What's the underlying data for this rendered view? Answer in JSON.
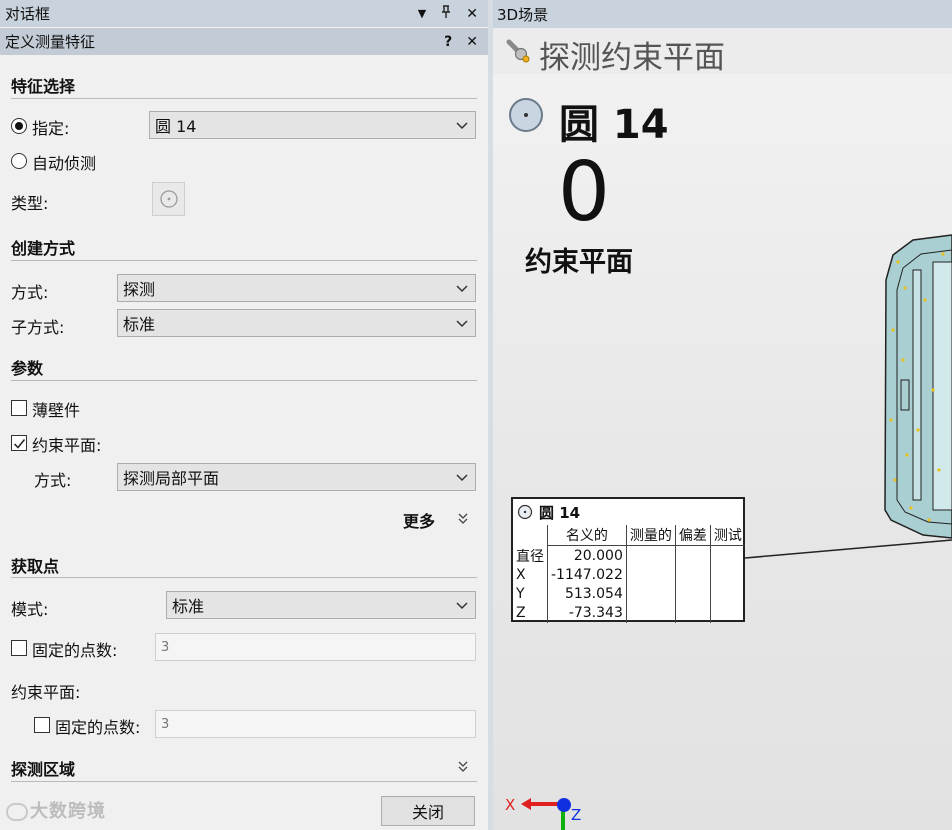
{
  "left_panel": {
    "window_title": "对话框",
    "dialog_title": "定义测量特征",
    "window_buttons": {
      "pin": "▼",
      "dock": "ᛘ",
      "close": "✕"
    },
    "dialog_buttons": {
      "help": "?",
      "close": "✕"
    },
    "feature_selection": {
      "header": "特征选择",
      "specify_label": "指定:",
      "specify_selected": true,
      "specify_value": "圆 14",
      "auto_detect_label": "自动侦测",
      "type_label": "类型:"
    },
    "creation_method": {
      "header": "创建方式",
      "method_label": "方式:",
      "method_value": "探测",
      "submethod_label": "子方式:",
      "submethod_value": "标准"
    },
    "parameters": {
      "header": "参数",
      "thin_wall_label": "薄壁件",
      "thin_wall_checked": false,
      "constraint_plane_label": "约束平面:",
      "constraint_plane_checked": true,
      "cp_method_label": "方式:",
      "cp_method_value": "探测局部平面",
      "more_label": "更多"
    },
    "acquire_points": {
      "header": "获取点",
      "mode_label": "模式:",
      "mode_value": "标准",
      "fixed_points_label": "固定的点数:",
      "fixed_points_checked": false,
      "fixed_points_value": "3",
      "constraint_plane_label": "约束平面:",
      "cp_fixed_points_label": "固定的点数:",
      "cp_fixed_points_checked": false,
      "cp_fixed_points_value": "3"
    },
    "probe_area": {
      "header": "探测区域"
    },
    "close_button": "关闭",
    "watermark": "大数跨境"
  },
  "scene": {
    "window_title": "3D场景",
    "title": "探测约束平面",
    "feature_name": "圆 14",
    "counter_value": "0",
    "counter_label": "约束平面",
    "info_box": {
      "title": "圆 14",
      "columns": [
        "",
        "名义的",
        "测量的",
        "偏差",
        "测试"
      ],
      "rows": [
        {
          "label": "直径",
          "nominal": "20.000"
        },
        {
          "label": "X",
          "nominal": "-1147.022"
        },
        {
          "label": "Y",
          "nominal": "513.054"
        },
        {
          "label": "Z",
          "nominal": "-73.343"
        }
      ]
    },
    "axis_labels": {
      "x": "X",
      "z": "Z"
    },
    "colors": {
      "part_fill": "#a9cfd3",
      "part_outline": "#222222",
      "point_markers": "#e6c21a",
      "axis_x": "#e02020",
      "axis_y": "#10b010",
      "axis_z": "#1030e0"
    }
  }
}
